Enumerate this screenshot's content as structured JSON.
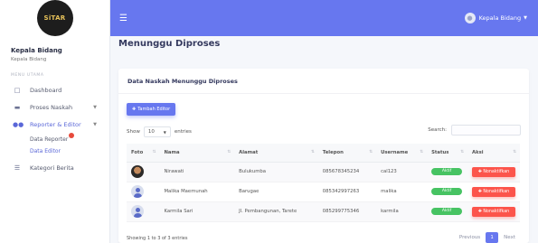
{
  "sidebar": {
    "logo_text": "SiTAR",
    "user_name": "Kepala Bidang",
    "user_role": "Kepala Bidang",
    "menu_title": "MENU UTAMA",
    "items": [
      {
        "label": "Dashboard",
        "icon": "monitor-icon"
      },
      {
        "label": "Proses Naskah",
        "icon": "file-icon"
      },
      {
        "label": "Reporter & Editor",
        "icon": "users-icon"
      },
      {
        "label": "Kategori Berita",
        "icon": "list-icon"
      }
    ],
    "subitems": [
      {
        "label": "Data Reporter"
      },
      {
        "label": "Data Editor"
      }
    ]
  },
  "topbar": {
    "user_name": "Kepala Bidang",
    "accent": "#6777ef"
  },
  "page": {
    "title": "Menunggu Diproses"
  },
  "card": {
    "header": "Data Naskah Menunggu Diproses",
    "add_button": "Tambah Editor",
    "show_label": "Show",
    "show_value": "10",
    "entries_label": "entries",
    "search_label": "Search:",
    "columns": [
      "Foto",
      "Nama",
      "Alamat",
      "Telepon",
      "Username",
      "Status",
      "Aksi"
    ],
    "rows": [
      {
        "photo": "photo",
        "nama": "Nirawati",
        "alamat": "Bulukumba",
        "telepon": "085678345234",
        "username": "cal123",
        "status": "Aktif",
        "aksi": "Nonaktifkan"
      },
      {
        "photo": "default",
        "nama": "Malika Maemunah",
        "alamat": "Barugae",
        "telepon": "085342997263",
        "username": "malika",
        "status": "Aktif",
        "aksi": "Nonaktifkan"
      },
      {
        "photo": "default",
        "nama": "Karmila Sari",
        "alamat": "Jl. Pembangunan, Tarete",
        "telepon": "085299775346",
        "username": "karmila",
        "status": "Aktif",
        "aksi": "Nonaktifkan"
      }
    ],
    "info": "Showing 1 to 3 of 3 entries",
    "pagination": {
      "previous": "Previous",
      "current": "1",
      "next": "Next"
    }
  }
}
